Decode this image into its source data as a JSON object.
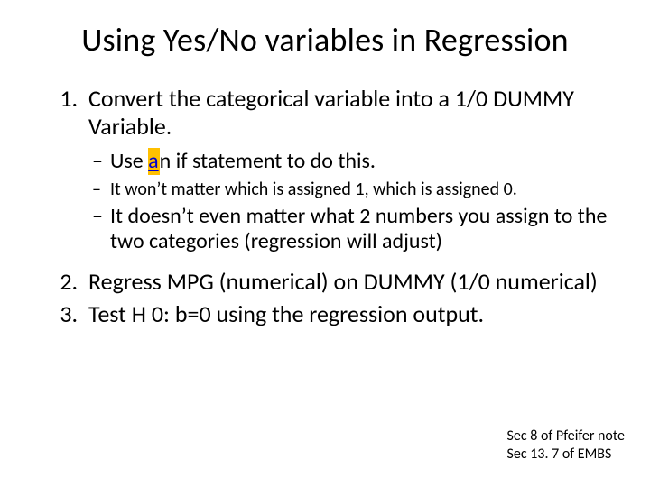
{
  "title": "Using Yes/No variables in Regression",
  "items": [
    {
      "text": "Convert the categorical variable into a 1/0 DUMMY Variable.",
      "sub": [
        {
          "pre": "Use ",
          "link": "a",
          "post": "n if statement to do this.",
          "class": "lvl-a"
        },
        {
          "text": "It won’t matter which is assigned 1, which is assigned 0.",
          "class": "lvl-b"
        },
        {
          "text": "It doesn’t even matter what 2 numbers you assign to the two categories (regression will adjust)",
          "class": "lvl-a"
        }
      ]
    },
    {
      "text": "Regress MPG (numerical) on DUMMY (1/0 numerical)"
    },
    {
      "text": "Test H 0: b=0 using the regression output."
    }
  ],
  "footer": {
    "line1": "Sec 8 of Pfeifer note",
    "line2": "Sec 13. 7 of EMBS"
  }
}
